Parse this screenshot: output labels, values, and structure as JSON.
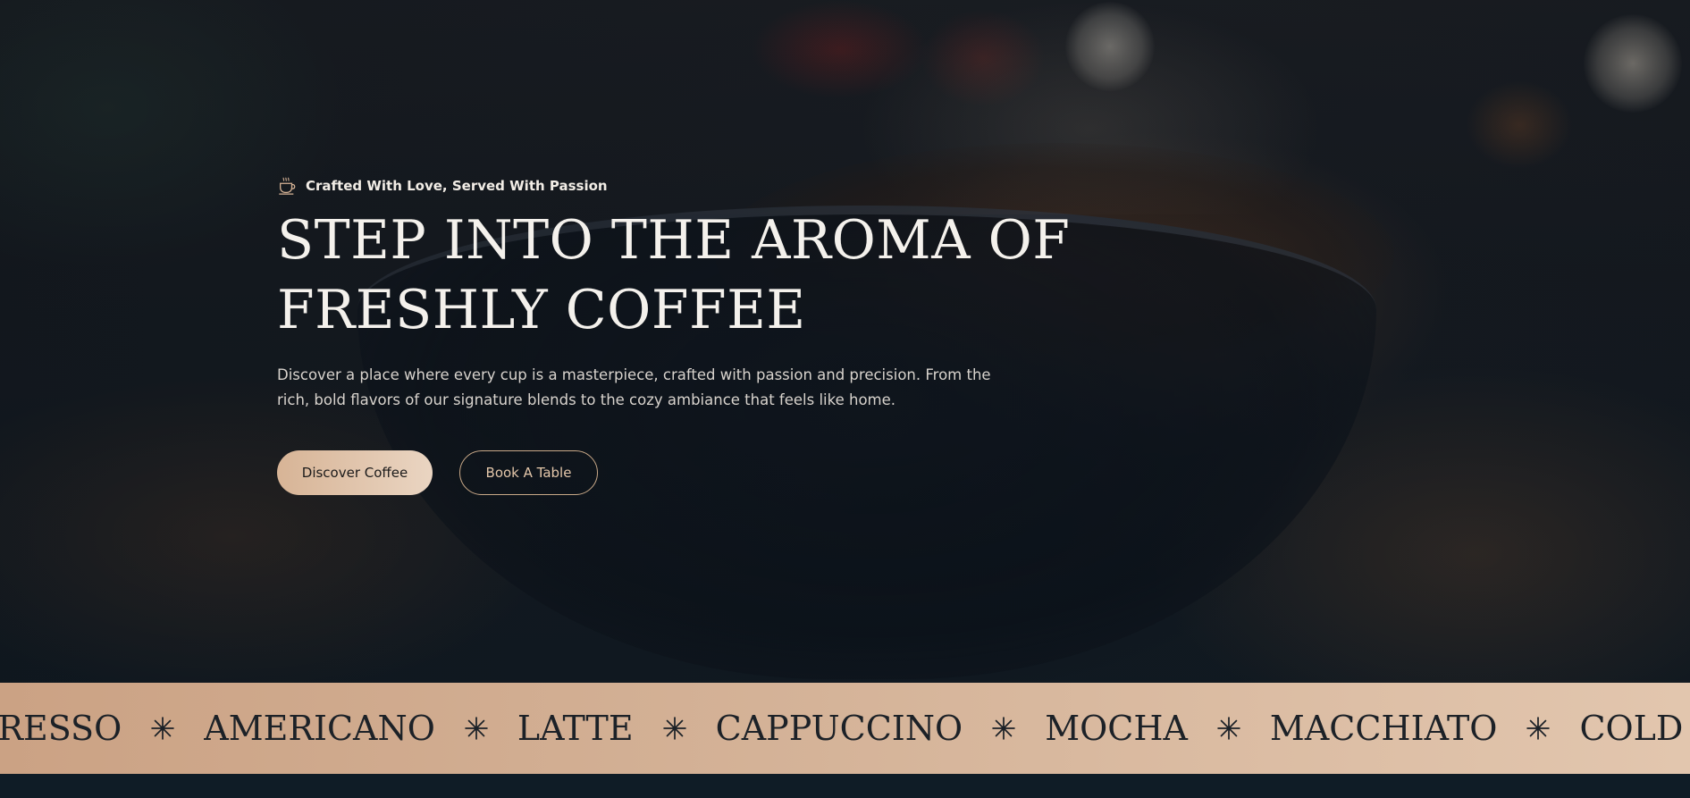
{
  "hero": {
    "eyebrow_icon": "coffee-cup-icon",
    "eyebrow": "Crafted With Love, Served With Passion",
    "headline_line1": "STEP INTO THE AROMA OF",
    "headline_line2": "FRESHLY COFFEE",
    "description": "Discover a place where every cup is a masterpiece, crafted with passion and precision. From the rich, bold flavors of our signature blends to the cozy ambiance that feels like home.",
    "primary_button": "Discover Coffee",
    "secondary_button": "Book A Table"
  },
  "marquee": {
    "separator_icon": "sparkle-star-icon",
    "items": [
      "ESPRESSO",
      "AMERICANO",
      "LATTE",
      "CAPPUCCINO",
      "MOCHA",
      "MACCHIATO",
      "COLD BREW"
    ]
  },
  "colors": {
    "accent": "#D7B496",
    "accent_light": "#EAD5C2",
    "background": "#0F1A22",
    "text_light": "#F4F1EC"
  }
}
